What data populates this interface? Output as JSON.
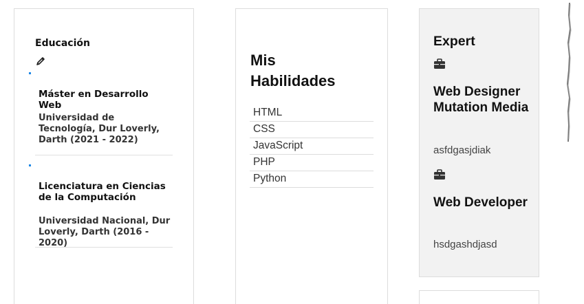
{
  "education": {
    "title": "Educación",
    "edit_icon": "pencil-icon",
    "items": [
      {
        "degree": "Máster en Desarrollo Web",
        "school": "Universidad de Tecnología, Dur Loverly, Darth (2021 - 2022)"
      },
      {
        "degree": "Licenciatura en Ciencias de la Computación",
        "school": "Universidad Nacional, Dur Loverly, Darth (2016 - 2020)"
      }
    ]
  },
  "skills": {
    "title": "Mis Habilidades",
    "items": [
      "HTML",
      "CSS",
      "JavaScript",
      "PHP",
      "Python"
    ]
  },
  "experience": {
    "title": "Expert",
    "icon": "briefcase-icon",
    "items": [
      {
        "role": "Web Designer Mutation Media",
        "description": "asfdgasjdiak"
      },
      {
        "role": "Web Developer",
        "description": "hsdgashdjasd"
      }
    ]
  },
  "colors": {
    "accent_dot": "#1e88e5",
    "experience_bg": "#f2f2f2",
    "border": "#dcdcdc"
  }
}
